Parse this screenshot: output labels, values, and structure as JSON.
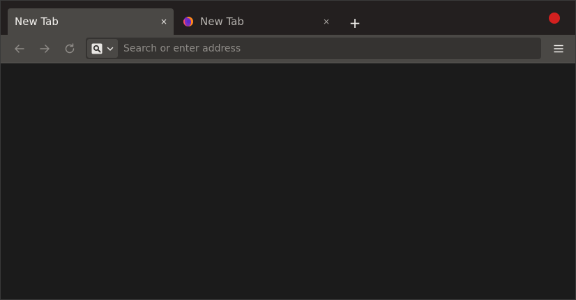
{
  "tabs": [
    {
      "label": "New Tab",
      "active": true,
      "close": "×"
    },
    {
      "label": "New Tab",
      "active": false,
      "close": "×",
      "favicon": "firefox-icon"
    }
  ],
  "newtab": {
    "label": "+"
  },
  "indicator": {
    "color": "#d3201f",
    "icon": "record-indicator-icon"
  },
  "navbar": {
    "back_icon": "back-arrow-icon",
    "forward_icon": "forward-arrow-icon",
    "reload_icon": "reload-icon",
    "search_engine_icon": "search-icon",
    "dropdown_icon": "chevron-down-icon",
    "menu_icon": "hamburger-menu-icon"
  },
  "urlbar": {
    "placeholder": "Search or enter address",
    "value": ""
  },
  "colors": {
    "tabstrip": "#231f1f",
    "active_tab": "#4a4845",
    "navbar": "#4a4845",
    "content": "#1b1b1b"
  }
}
